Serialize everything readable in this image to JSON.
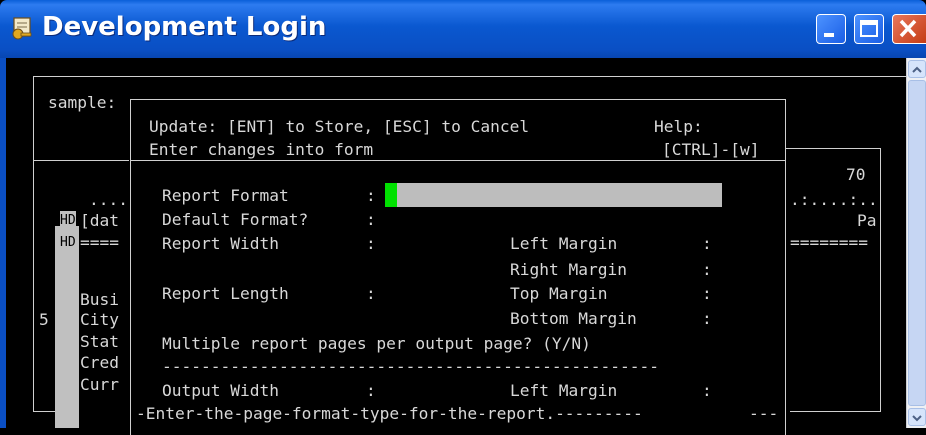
{
  "window": {
    "title": "Development Login",
    "title_icon": "key-icon"
  },
  "background_form": {
    "label_sample": "sample:",
    "ruler_70": "70",
    "dots_left": "....",
    "dots_right": ".:....:..",
    "row_dat": "[dat",
    "row_pa": "Pa",
    "row_eq_left": "====",
    "row_eq_right": "========",
    "hd1": "HD",
    "hd2": "HD",
    "field_busi": "Busi",
    "field_city": "City",
    "field_stat": "Stat",
    "field_cred": "Cred",
    "field_curr": "Curr",
    "num5": "5"
  },
  "dialog": {
    "update_line": "Update: [ENT] to Store, [ESC] to Cancel",
    "help_label": "Help:",
    "enter_line": "Enter changes into form",
    "help_keys": "[CTRL]-[w]",
    "report_format_label": "Report Format",
    "default_format_label": "Default Format?",
    "report_width_label": "Report Width",
    "report_length_label": "Report Length",
    "left_margin_label": "Left Margin",
    "right_margin_label": "Right Margin",
    "top_margin_label": "Top Margin",
    "bottom_margin_label": "Bottom Margin",
    "colon": ":",
    "multiple_pages_label": "Multiple report pages per output page? (Y/N)",
    "separator": "---------------------------------------------------",
    "output_width_label": "Output Width",
    "output_left_margin_label": "Left Margin",
    "status_line": "-Enter-the-page-format-type-for-the-report.---------",
    "status_tail": "---"
  },
  "colors": {
    "titlebar": "#0a4fc4",
    "cursor": "#00e000",
    "field": "#bdbdbd"
  }
}
